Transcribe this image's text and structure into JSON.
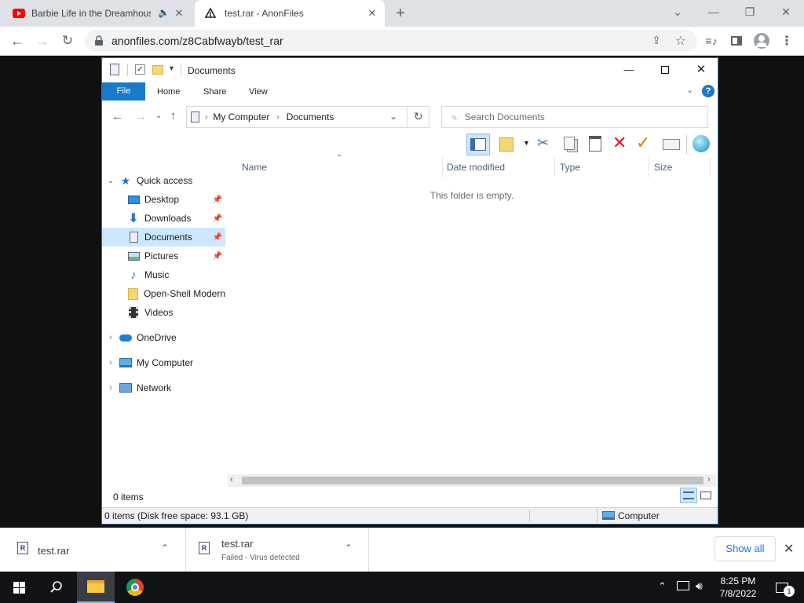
{
  "browser": {
    "tabs": [
      {
        "title": "Barbie Life in the Dreamhous",
        "icon": "youtube-icon"
      },
      {
        "title": "test.rar - AnonFiles",
        "icon": "anonfiles-icon"
      }
    ],
    "url": "anonfiles.com/z8Cabfwayb/test_rar"
  },
  "explorer": {
    "title": "Documents",
    "ribbon_tabs": [
      "File",
      "Home",
      "Share",
      "View"
    ],
    "breadcrumb": [
      "My Computer",
      "Documents"
    ],
    "search_placeholder": "Search Documents",
    "columns": [
      "Name",
      "Date modified",
      "Type",
      "Size"
    ],
    "empty_message": "This folder is empty.",
    "quick_access_label": "Quick access",
    "quick_access_items": [
      {
        "label": "Desktop",
        "icon": "desktop-icon",
        "pinned": true
      },
      {
        "label": "Downloads",
        "icon": "downloads-icon",
        "pinned": true
      },
      {
        "label": "Documents",
        "icon": "documents-icon",
        "pinned": true,
        "selected": true
      },
      {
        "label": "Pictures",
        "icon": "pictures-icon",
        "pinned": true
      },
      {
        "label": "Music",
        "icon": "music-icon",
        "pinned": false
      },
      {
        "label": "Open-Shell Modern",
        "icon": "folder-icon",
        "pinned": false
      },
      {
        "label": "Videos",
        "icon": "videos-icon",
        "pinned": false
      }
    ],
    "tree_items": [
      {
        "label": "OneDrive",
        "icon": "onedrive-icon"
      },
      {
        "label": "My Computer",
        "icon": "computer-icon"
      },
      {
        "label": "Network",
        "icon": "network-icon"
      }
    ],
    "item_count": "0 items",
    "status_detail": "0 items (Disk free space: 93.1 GB)",
    "status_location": "Computer"
  },
  "downloads": [
    {
      "filename": "test.rar",
      "status": ""
    },
    {
      "filename": "test.rar",
      "status": "Failed - Virus detected"
    }
  ],
  "downloads_show_all": "Show all",
  "taskbar": {
    "time": "8:25 PM",
    "date": "7/8/2022",
    "notification_count": "1"
  },
  "colors": {
    "accent": "#1979ca",
    "selection": "#cce8ff",
    "delete_red": "#e81123",
    "check_orange": "#e07b10"
  }
}
